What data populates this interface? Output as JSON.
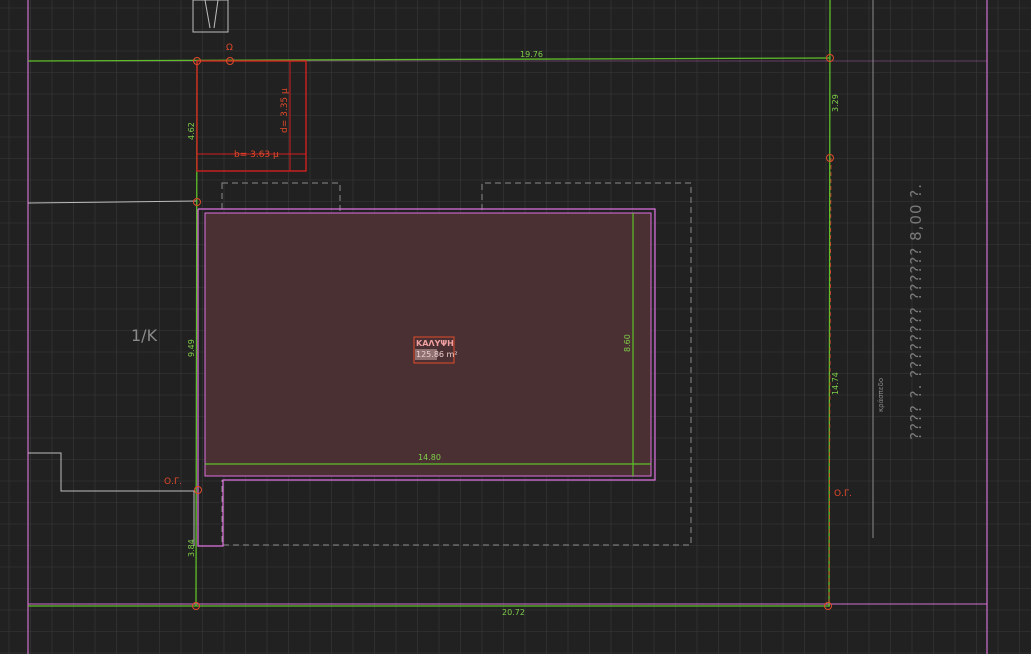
{
  "labels": {
    "parcel_id": "1/K",
    "coverage_title": "ΚΑΛΥΨΗ",
    "coverage_value": "125.86 m²",
    "road_text": "???? ?. ???????? ?????? 8,00 ?.",
    "road_side_label": "κράσπεδο",
    "og_left": "Ο.Γ.",
    "og_right": "Ο.Γ.",
    "og_point": "Ο.Γ."
  },
  "dimensions": {
    "top": "19.76",
    "bottom": "20.72",
    "right_top": "3.29",
    "right_main": "14.74",
    "left_top": "4.62",
    "left_mid": "9.49",
    "left_bottom": "3.84",
    "building_width": "14.80",
    "building_depth": "8.60",
    "annex_width": "b= 3.63 μ",
    "annex_height": "d= 3.35 μ",
    "point_label": "Ω"
  },
  "colors": {
    "background": "#212121",
    "grid": "#3a3a3a",
    "plot_line": "#5fbf2a",
    "building_fill": "#4a3032",
    "building_outline": "#e070e0",
    "annex": "#d02020",
    "dashed": "#9a9a9a"
  }
}
